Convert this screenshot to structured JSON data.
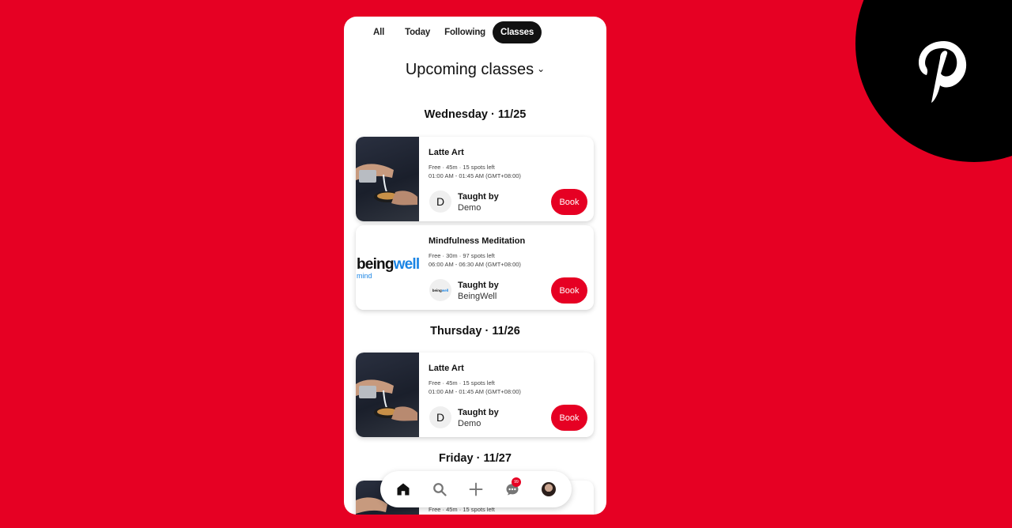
{
  "brand": {
    "name": "Pinterest",
    "icon": "pinterest-logo-icon"
  },
  "tabs": [
    {
      "label": "All",
      "active": false
    },
    {
      "label": "Today",
      "active": false
    },
    {
      "label": "Following",
      "active": false
    },
    {
      "label": "Classes",
      "active": true
    }
  ],
  "heading": {
    "title": "Upcoming classes",
    "icon": "chevron-down-icon"
  },
  "days": [
    {
      "label": "Wednesday · 11/25",
      "classes": [
        {
          "title": "Latte Art",
          "meta_line1": "Free · 45m · 15 spots left",
          "meta_line2": "01:00 AM - 01:45 AM (GMT+08:00)",
          "thumbnail": "latte-art-photo",
          "taught_by_label": "Taught by",
          "host_initial": "D",
          "host_name": "Demo",
          "book_label": "Book"
        },
        {
          "title": "Mindfulness Meditation",
          "meta_line1": "Free · 30m · 97 spots left",
          "meta_line2": "06:00 AM - 06:30 AM (GMT+08:00)",
          "thumbnail": "beingwell-logo",
          "logo_text_a": "being",
          "logo_text_b": "well",
          "logo_sub": "mind",
          "taught_by_label": "Taught by",
          "host_logo_a": "being",
          "host_logo_b": "well",
          "host_name": "BeingWell",
          "book_label": "Book"
        }
      ]
    },
    {
      "label": "Thursday · 11/26",
      "classes": [
        {
          "title": "Latte Art",
          "meta_line1": "Free · 45m · 15 spots left",
          "meta_line2": "01:00 AM - 01:45 AM (GMT+08:00)",
          "thumbnail": "latte-art-photo",
          "taught_by_label": "Taught by",
          "host_initial": "D",
          "host_name": "Demo",
          "book_label": "Book"
        }
      ]
    },
    {
      "label": "Friday · 11/27",
      "classes": [
        {
          "meta_line1": "Free · 45m · 15 spots left",
          "thumbnail": "latte-art-photo"
        }
      ]
    }
  ],
  "bottom_nav": [
    {
      "name": "home",
      "icon": "home-icon",
      "active": true
    },
    {
      "name": "search",
      "icon": "search-icon"
    },
    {
      "name": "create",
      "icon": "plus-icon"
    },
    {
      "name": "messages",
      "icon": "chat-icon",
      "badge": "99"
    },
    {
      "name": "profile",
      "icon": "avatar-icon"
    }
  ],
  "colors": {
    "brand_red": "#e60023",
    "black": "#000000",
    "beingwell_blue": "#1a84e4"
  }
}
